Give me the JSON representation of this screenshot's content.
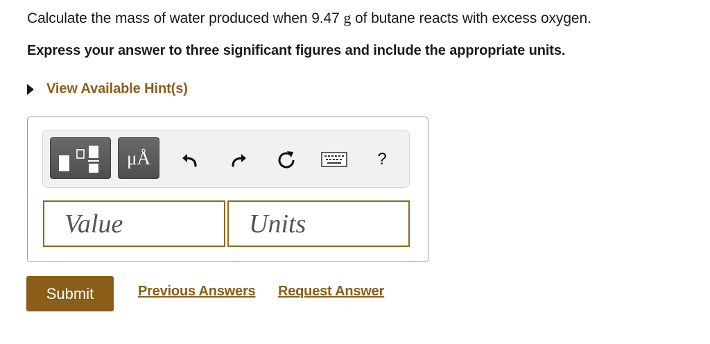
{
  "question": {
    "prefix": "Calculate the mass of water produced when 9.47 ",
    "unit_g": "g",
    "suffix": " of butane reacts with excess oxygen."
  },
  "instruction": "Express your answer to three significant figures and include the appropriate units.",
  "hint": {
    "label": "View Available Hint(s)"
  },
  "toolbar": {
    "units_label": "μÅ",
    "help_label": "?",
    "icons": [
      "templates-icon",
      "units-icon",
      "undo-icon",
      "redo-icon",
      "reset-icon",
      "keyboard-icon",
      "help-icon"
    ]
  },
  "inputs": {
    "value_placeholder": "Value",
    "units_placeholder": "Units"
  },
  "actions": {
    "submit_label": "Submit",
    "previous_answers_label": "Previous Answers",
    "request_answer_label": "Request Answer"
  },
  "colors": {
    "accent": "#8a5e18",
    "field_border": "#8a6a1a",
    "toolbar_button": "#5a5a5a"
  }
}
